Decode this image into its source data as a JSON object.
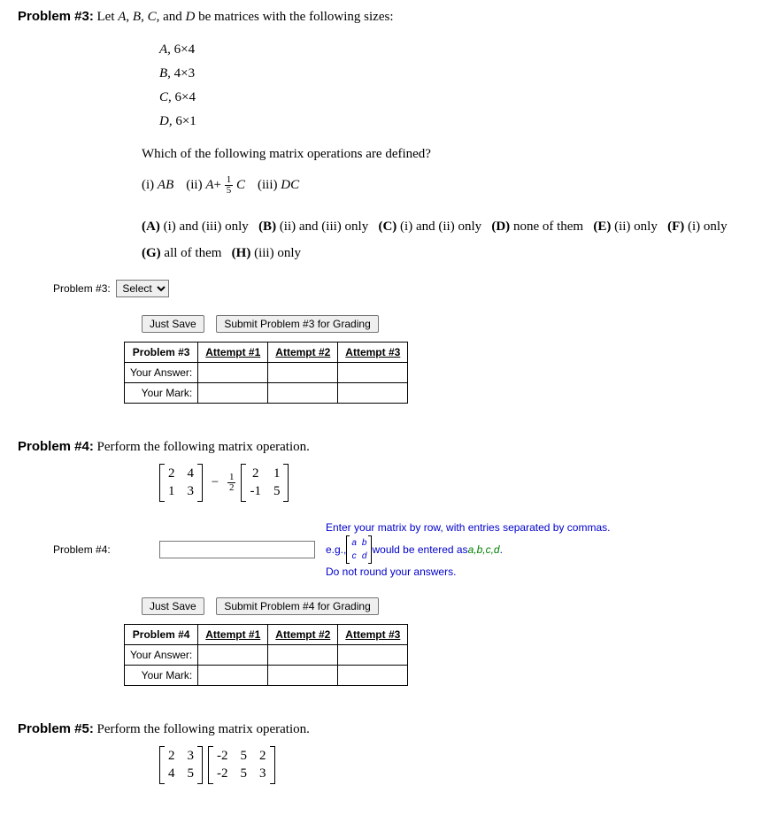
{
  "p3": {
    "header": "Problem #3:",
    "intro": "Let A, B, C, and D be matrices with the following sizes:",
    "sizes": {
      "A": "6×4",
      "B": "4×3",
      "C": "6×4",
      "D": "6×1"
    },
    "question": "Which of the following matrix operations are defined?",
    "ops": {
      "i": "(i) AB",
      "ii_pre": "(ii) A + ",
      "ii_num": "1",
      "ii_den": "5",
      "ii_post": " C",
      "iii": "(iii) DC"
    },
    "choices": {
      "A": "(i) and (iii) only",
      "B": "(ii) and (iii) only",
      "C": "(i) and (ii) only",
      "D": "none of them",
      "E": "(ii) only",
      "F": "(i) only",
      "G": "all of them",
      "H": "(iii) only"
    },
    "answer_label": "Problem #3:",
    "select_placeholder": "Select",
    "save_btn": "Just Save",
    "submit_btn": "Submit Problem #3 for Grading",
    "table": {
      "corner": "Problem #3",
      "attempts": [
        "Attempt #1",
        "Attempt #2",
        "Attempt #3"
      ],
      "row_answer": "Your Answer:",
      "row_mark": "Your Mark:"
    }
  },
  "p4": {
    "header": "Problem #4:",
    "intro": "Perform the following matrix operation.",
    "matrixA": [
      [
        2,
        4
      ],
      [
        1,
        3
      ]
    ],
    "minus": "−",
    "scalar_num": "1",
    "scalar_den": "2",
    "matrixB": [
      [
        2,
        1
      ],
      [
        -1,
        5
      ]
    ],
    "answer_label": "Problem #4:",
    "hint_line1": "Enter your matrix by row, with entries separated by commas.",
    "hint_eg": "e.g., ",
    "hint_mat": [
      [
        "a",
        "b"
      ],
      [
        "c",
        "d"
      ]
    ],
    "hint_post": " would be entered as ",
    "hint_abcd": "a,b,c,d",
    "hint_dot": ".",
    "hint_line3": "Do not round your answers.",
    "save_btn": "Just Save",
    "submit_btn": "Submit Problem #4 for Grading",
    "table": {
      "corner": "Problem #4",
      "attempts": [
        "Attempt #1",
        "Attempt #2",
        "Attempt #3"
      ],
      "row_answer": "Your Answer:",
      "row_mark": "Your Mark:"
    }
  },
  "p5": {
    "header": "Problem #5:",
    "intro": "Perform the following matrix operation.",
    "matrixA": [
      [
        2,
        3
      ],
      [
        4,
        5
      ]
    ],
    "matrixB": [
      [
        -2,
        5,
        2
      ],
      [
        -2,
        5,
        3
      ]
    ]
  },
  "chart_data": {
    "type": "table",
    "problem3": {
      "matrices": {
        "A": "6×4",
        "B": "4×3",
        "C": "6×4",
        "D": "6×1"
      },
      "operations": [
        "AB",
        "A + (1/5)C",
        "DC"
      ],
      "choices": {
        "A": "(i) and (iii) only",
        "B": "(ii) and (iii) only",
        "C": "(i) and (ii) only",
        "D": "none of them",
        "E": "(ii) only",
        "F": "(i) only",
        "G": "all of them",
        "H": "(iii) only"
      }
    },
    "problem4": {
      "operation": "[[2,4],[1,3]] - (1/2)*[[2,1],[-1,5]]"
    },
    "problem5": {
      "operation": "[[2,3],[4,5]] * [[-2,5,2],[-2,5,3]]"
    }
  }
}
